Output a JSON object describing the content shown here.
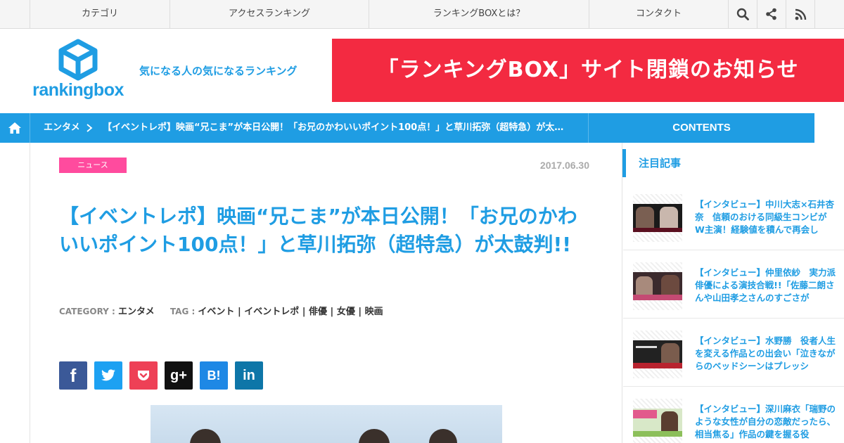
{
  "topnav": {
    "items": [
      "カテゴリ",
      "アクセスランキング",
      "ランキングBOXとは？",
      "コンタクト"
    ],
    "icons": [
      "search-icon",
      "share-icon",
      "rss-icon"
    ]
  },
  "header": {
    "logo_text": "rankingbox",
    "tagline": "気になる人の気になるランキング",
    "banner": "「ランキングBOX」サイト閉鎖のお知らせ"
  },
  "breadcrumb": {
    "category": "エンタメ",
    "separator": ">",
    "title": "【イベントレポ】映画“兄こま”が本日公開！「お兄のかわいいポイント100点！」と草川拓弥（超特急）が太鼓判!!",
    "contents_label": "CONTENTS"
  },
  "article": {
    "tag": "ニュース",
    "date": "2017.06.30",
    "headline": "【イベントレポ】映画“兄こま”が本日公開！「お兄のかわいいポイント100点！」と草川拓弥（超特急）が太鼓判!!",
    "category_key": "CATEGORY :",
    "category_value": "エンタメ",
    "tag_key": "TAG :",
    "tag_value": "イベント | イベントレポ | 俳優 | 女優 | 映画"
  },
  "share": [
    {
      "name": "facebook",
      "label": "f",
      "color": "#3b5998"
    },
    {
      "name": "twitter",
      "label": "",
      "color": "#1da1f2"
    },
    {
      "name": "pocket",
      "label": "",
      "color": "#ee4056"
    },
    {
      "name": "google-plus",
      "label": "g+",
      "color": "#111111"
    },
    {
      "name": "hatena",
      "label": "B!",
      "color": "#1e88e5"
    },
    {
      "name": "linkedin",
      "label": "in",
      "color": "#0e76a8"
    }
  ],
  "sidebar": {
    "heading": "注目記事",
    "items": [
      "【インタビュー】中川大志×石井杏奈　信頼のおける同級生コンビがW主演！経験値を積んで再会し",
      "【インタビュー】仲里依紗　実力派俳優による演技合戦!!「佐藤二朗さんや山田孝之さんのすごさが",
      "【インタビュー】水野勝　役者人生を変える作品との出会い「泣きながらのベッドシーンはプレッシ",
      "【インタビュー】深川麻衣「瑞野のような女性が自分の恋敵だったら、相当焦る」作品の鍵を握る役"
    ]
  },
  "colors": {
    "accent": "#1f9de3",
    "banner": "#f32a41",
    "news_tag": "#ff4b9e"
  }
}
